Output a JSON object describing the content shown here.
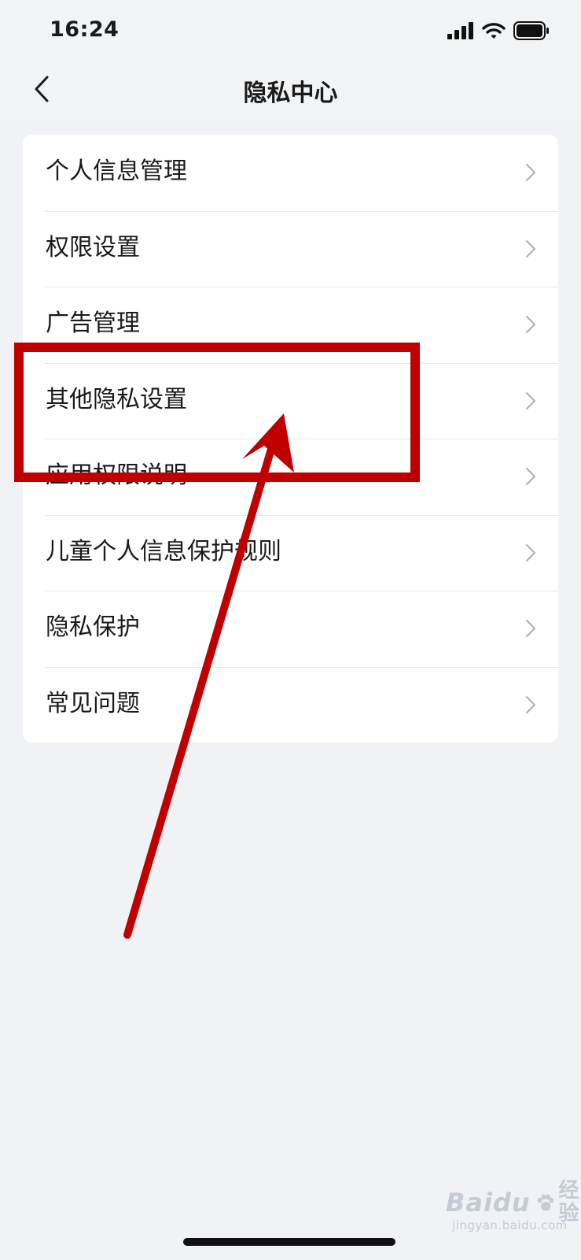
{
  "status_bar": {
    "time": "16:24",
    "icons": [
      "signal-icon",
      "wifi-icon",
      "battery-icon"
    ]
  },
  "header": {
    "title": "隐私中心",
    "back_icon": "chevron-left-icon"
  },
  "menu": {
    "items": [
      {
        "label": "个人信息管理"
      },
      {
        "label": "权限设置"
      },
      {
        "label": "广告管理"
      },
      {
        "label": "其他隐私设置"
      },
      {
        "label": "应用权限说明"
      },
      {
        "label": "儿童个人信息保护规则"
      },
      {
        "label": "隐私保护"
      },
      {
        "label": "常见问题"
      }
    ]
  },
  "annotation": {
    "highlighted_item": "其他隐私设置",
    "color": "#c00000"
  },
  "watermark": {
    "brand": "Baidu",
    "sub": "经验",
    "url": "jingyan.baidu.com"
  },
  "colors": {
    "background": "#f0f2f5",
    "card": "#ffffff",
    "text": "#1a1a1a",
    "chevron": "#b0b0b0"
  }
}
